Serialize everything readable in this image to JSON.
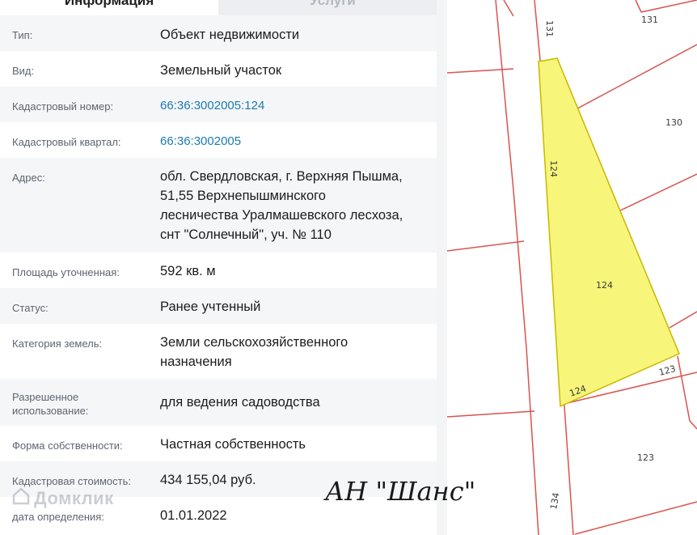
{
  "tabs": [
    {
      "label": "Информация",
      "active": true
    },
    {
      "label": "Услуги",
      "active": false
    }
  ],
  "fields": [
    {
      "label": "Тип:",
      "value": "Объект недвижимости",
      "link": false
    },
    {
      "label": "Вид:",
      "value": "Земельный участок",
      "link": false
    },
    {
      "label": "Кадастровый номер:",
      "value": "66:36:3002005:124",
      "link": true
    },
    {
      "label": "Кадастровый квартал:",
      "value": "66:36:3002005",
      "link": true
    },
    {
      "label": "Адрес:",
      "value": "обл. Свердловская, г. Верхняя Пышма,\n51,55 Верхнепышминского\nлесничества Уралмашевского лесхоза,\nснт \"Солнечный\", уч. № 110",
      "link": false
    },
    {
      "label": "Площадь уточненная:",
      "value": "592 кв. м",
      "link": false
    },
    {
      "label": "Статус:",
      "value": "Ранее учтенный",
      "link": false
    },
    {
      "label": "Категория земель:",
      "value": "Земли сельскохозяйственного\nназначения",
      "link": false
    },
    {
      "label": "Разрешенное\nиспользование:",
      "value": "для ведения садоводства",
      "link": false
    },
    {
      "label": "Форма собственности:",
      "value": "Частная собственность",
      "link": false
    },
    {
      "label": "Кадастровая стоимость:",
      "value": "434 155,04 руб.",
      "link": false
    },
    {
      "label": "дата определения:",
      "value": "01.01.2022",
      "link": false
    }
  ],
  "watermark": {
    "brand": "Домклик"
  },
  "signature": {
    "text": "АН \"Шанс\""
  },
  "map": {
    "plot_labels": [
      "131",
      "131",
      "130",
      "124",
      "124",
      "124",
      "123",
      "123",
      "134"
    ],
    "colors": {
      "highlight_fill": "#f7f57a",
      "highlight_stroke": "#c9b800",
      "boundary": "#d9534f",
      "background": "#ffffff"
    }
  }
}
